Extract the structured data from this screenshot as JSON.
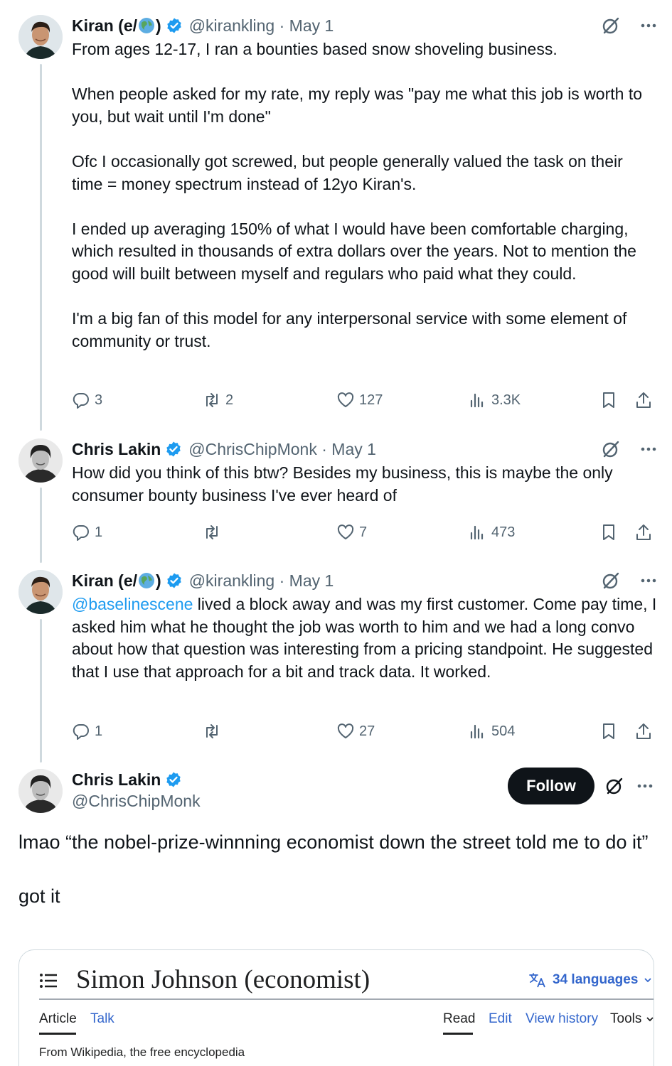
{
  "tweets": [
    {
      "name": "Kiran (e/",
      "name_suffix": ")",
      "handle": "@kirankling",
      "separator": "·",
      "date": "May 1",
      "text": "From ages 12-17, I ran a bounties based snow shoveling business.\n\nWhen people asked for my rate, my reply was \"pay me what this job is worth to you, but wait until I'm done\"\n\nOfc I occasionally got screwed, but people generally valued the task on their time = money spectrum instead of 12yo Kiran's.\n\nI ended up averaging 150% of what I would have been comfortable charging, which resulted in thousands of extra dollars over the years. Not to mention the good will built between myself and regulars who paid what they could.\n\nI'm a big fan of this model for any interpersonal service with some element of community or trust.",
      "replies": "3",
      "reposts": "2",
      "likes": "127",
      "views": "3.3K"
    },
    {
      "name": "Chris Lakin",
      "handle": "@ChrisChipMonk",
      "separator": "·",
      "date": "May 1",
      "text": "How did you think of this btw? Besides my business, this is maybe the only consumer bounty business I've ever heard of",
      "replies": "1",
      "reposts": "",
      "likes": "7",
      "views": "473"
    },
    {
      "name": "Kiran (e/",
      "name_suffix": ")",
      "handle": "@kirankling",
      "separator": "·",
      "date": "May 1",
      "mention": "@baselinescene",
      "text": " lived a block away and was my first customer. Come pay time, I asked him what he thought the job was worth to him and we had a long convo about how that question was interesting from a pricing standpoint. He suggested that I use that approach for a bit and track data. It worked.",
      "replies": "1",
      "reposts": "",
      "likes": "27",
      "views": "504"
    }
  ],
  "main_tweet": {
    "name": "Chris Lakin",
    "handle": "@ChrisChipMonk",
    "follow_label": "Follow",
    "text": "lmao “the nobel-prize-winnning economist down the street told me to do it”\n\ngot it"
  },
  "wiki_card": {
    "title": "Simon Johnson (economist)",
    "languages": "34 languages",
    "tabs_left": [
      "Article",
      "Talk"
    ],
    "tabs_right": [
      "Read",
      "Edit",
      "View history",
      "Tools"
    ],
    "from": "From Wikipedia, the free encyclopedia"
  },
  "icons": {
    "verified": "verified-badge-icon",
    "globe": "globe-emoji-icon",
    "grok": "grok-icon",
    "more": "more-icon",
    "reply": "reply-icon",
    "repost": "repost-icon",
    "like": "like-icon",
    "views": "views-icon",
    "bookmark": "bookmark-icon",
    "share": "share-icon",
    "menu": "menu-icon",
    "translate": "translate-icon"
  },
  "colors": {
    "text": "#0f1419",
    "secondary": "#536471",
    "verified": "#1d9bf0",
    "link": "#1d9bf0",
    "wiki_link": "#3366cc",
    "follow_bg": "#0f1419"
  }
}
